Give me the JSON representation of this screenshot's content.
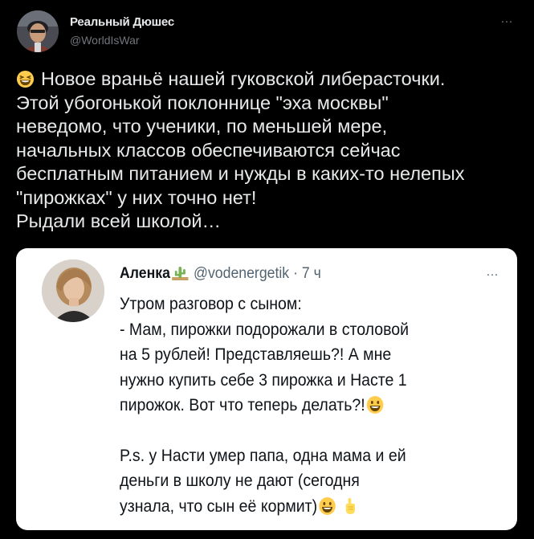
{
  "author": {
    "display_name": "Реальный Дюшес",
    "handle": "@WorldIsWar"
  },
  "tweet": {
    "emoji": "laughing-face",
    "lines": [
      "Новое враньё нашей гуковской либерасточки.",
      "Этой убогонькой поклоннице \"эха москвы\"",
      "неведомо, что ученики, по меньшей мере,",
      "начальных классов обеспечиваются сейчас",
      "бесплатным питанием и нужды в каких-то нелепых",
      "\"пирожках\" у них точно нет!",
      "Рыдали всей школой…"
    ]
  },
  "quoted_tweet": {
    "display_name": "Аленка",
    "handle": "@vodenergetik",
    "separator": "·",
    "time": "7 ч",
    "paragraph1": [
      "Утром разговор с сыном:",
      "- Мам, пирожки подорожали в столовой",
      "на 5 рублей! Представляешь?! А мне",
      "нужно купить себе 3 пирожка и Насте 1",
      "пирожок. Вот что теперь делать?!"
    ],
    "paragraph2": [
      "P.s. у Насти умер папа, одна мама и ей",
      "деньги в школу не дают (сегодня",
      "узнала, что сын её кормит)"
    ]
  },
  "icons": {
    "more": "…",
    "emoji_1": "grinning-face",
    "emoji_2": "grinning-face",
    "emoji_3": "pointing-up-hand"
  },
  "colors": {
    "background": "#000000",
    "text_primary": "#e7e9ea",
    "text_secondary": "#71767b",
    "card_background": "#ffffff",
    "card_text": "#0f1419",
    "card_secondary": "#536471"
  }
}
